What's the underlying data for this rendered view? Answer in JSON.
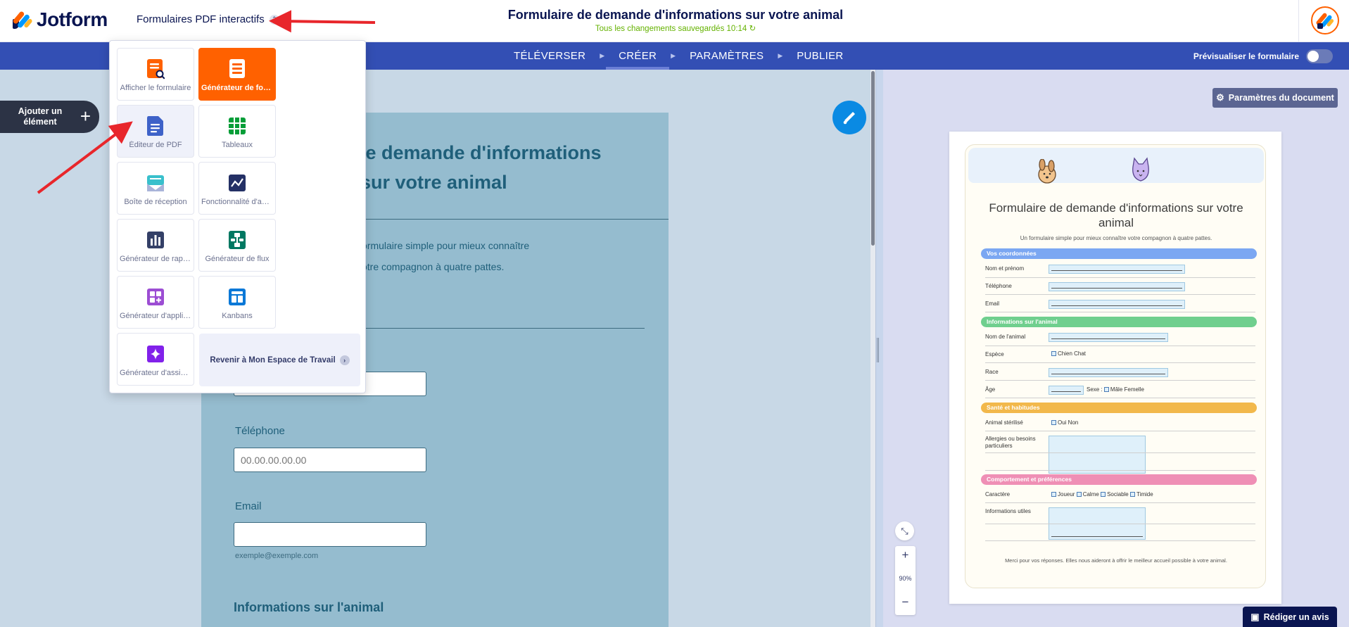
{
  "header": {
    "brand": "Jotform",
    "product_switch": "Formulaires PDF interactifs",
    "doc_title": "Formulaire de demande d'informations sur votre animal",
    "save_status": "Tous les changements sauvegardés 10:14 ↻"
  },
  "nav": {
    "tabs": [
      "TÉLÉVERSER",
      "CRÉER",
      "PARAMÈTRES",
      "PUBLIER"
    ],
    "active_tab": "CRÉER",
    "preview_label": "Prévisualiser le formulaire"
  },
  "builder": {
    "add_element": "Ajouter un élément",
    "form_title_line1": "le demande d'informations",
    "form_title_line2": "sur votre animal",
    "desc_line1": "ormulaire simple pour mieux connaître",
    "desc_line2": "otre compagnon à quatre pattes.",
    "phone_label": "Téléphone",
    "phone_placeholder": "00.00.00.00.00",
    "email_label": "Email",
    "email_help": "exemple@exemple.com",
    "section_animal": "Informations sur l'animal"
  },
  "dropdown": {
    "tiles": [
      {
        "label": "Afficher le formulaire",
        "icon": "form-view-icon",
        "color": "#ff6100"
      },
      {
        "label": "Générateur de formulaires",
        "icon": "form-builder-icon",
        "color": "#ffffff",
        "active": true
      },
      {
        "label": "Éditeur de PDF",
        "icon": "pdf-editor-icon",
        "color": "#3e62c8",
        "hover": true
      },
      {
        "label": "Tableaux",
        "icon": "tables-icon",
        "color": "#049e38"
      },
      {
        "label": "Boîte de réception",
        "icon": "inbox-icon",
        "color": "#39c0cc"
      },
      {
        "label": "Fonctionnalité d'approbation",
        "icon": "approvals-icon",
        "color": "#243065"
      },
      {
        "label": "Générateur de rapports",
        "icon": "reports-icon",
        "color": "#344067"
      },
      {
        "label": "Générateur de flux",
        "icon": "workflow-icon",
        "color": "#007862"
      },
      {
        "label": "Générateur d'applications",
        "icon": "apps-icon",
        "color": "#9c4dd3"
      },
      {
        "label": "Kanbans",
        "icon": "boards-icon",
        "color": "#0a78d7"
      },
      {
        "label": "Générateur d'assistants",
        "icon": "ai-agents-icon",
        "color": "#8121ea"
      }
    ],
    "back_label": "Revenir à Mon Espace de Travail"
  },
  "preview": {
    "doc_settings": "Paramètres du document",
    "title": "Formulaire de demande d'informations sur votre animal",
    "subtitle": "Un formulaire simple pour mieux connaître votre compagnon à quatre pattes.",
    "sections": [
      {
        "title": "Vos coordonnées",
        "color": "#7ba7f2"
      },
      {
        "title": "Informations sur l'animal",
        "color": "#6fcf8e"
      },
      {
        "title": "Santé et habitudes",
        "color": "#f2b84b"
      },
      {
        "title": "Comportement et préférences",
        "color": "#ef8fb5"
      }
    ],
    "fields": {
      "name": "Nom et prénom",
      "phone": "Téléphone",
      "email": "Email",
      "pet_name": "Nom de l'animal",
      "species": "Espèce",
      "species_opts": "Chien  Chat",
      "breed": "Race",
      "age": "Âge",
      "sex_label": "Sexe :",
      "sex_opts": "Mâle  Femelle",
      "sterilized": "Animal stérilisé",
      "sterilized_opts": "Oui  Non",
      "allergies": "Allergies ou besoins particuliers",
      "character": "Caractère",
      "character_opts": [
        "Joueur",
        "Calme",
        "Sociable",
        "Timide"
      ],
      "useful_info": "Informations utiles"
    },
    "footer": "Merci pour vos réponses. Elles nous aideront à offrir le meilleur accueil possible à votre animal.",
    "zoom": "90%",
    "review_label": "Rédiger un avis"
  }
}
